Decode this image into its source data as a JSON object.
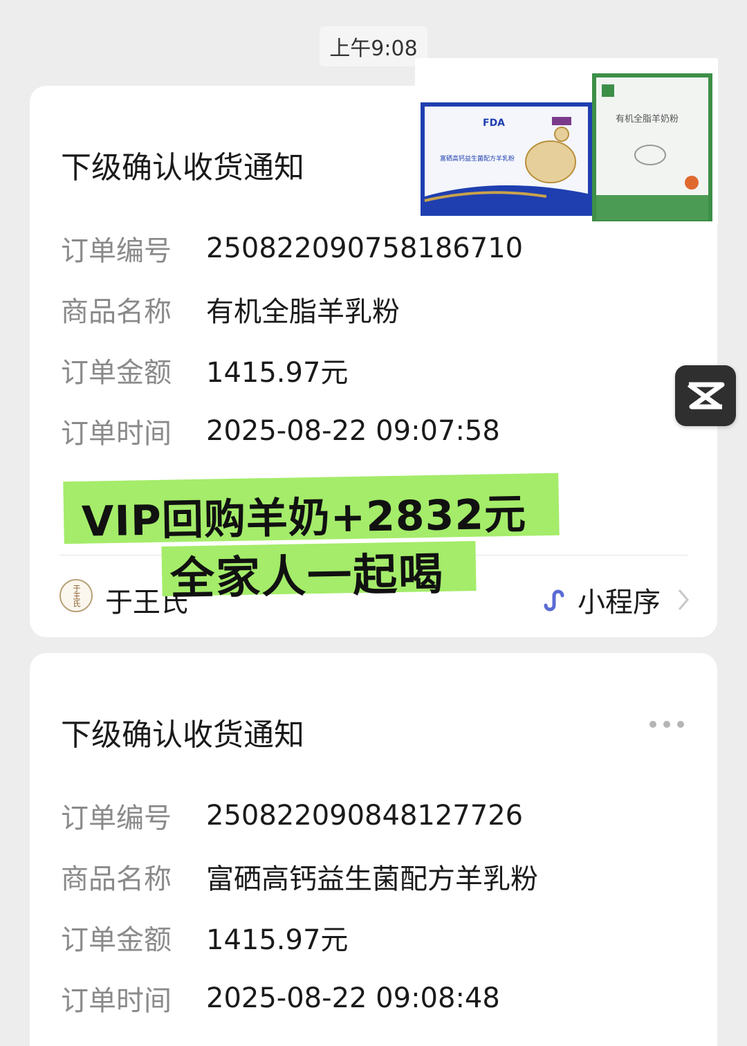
{
  "chat": {
    "timestamp": "上午9:08"
  },
  "cards": [
    {
      "title": "下级确认收货通知",
      "rows": [
        {
          "label": "订单编号",
          "value": "250822090758186710"
        },
        {
          "label": "商品名称",
          "value": "有机全脂羊乳粉"
        },
        {
          "label": "订单金额",
          "value": "1415.97元"
        },
        {
          "label": "订单时间",
          "value": "2025-08-22 09:07:58"
        }
      ],
      "source_name": "于王氏",
      "source_avatar_text": "于王氏",
      "mini_program_label": "小程序"
    },
    {
      "title": "下级确认收货通知",
      "rows": [
        {
          "label": "订单编号",
          "value": "250822090848127726"
        },
        {
          "label": "商品名称",
          "value": "富硒高钙益生菌配方羊乳粉"
        },
        {
          "label": "订单金额",
          "value": "1415.97元"
        },
        {
          "label": "订单时间",
          "value": "2025-08-22 09:08:48"
        }
      ]
    }
  ],
  "product_image": {
    "box1_brand": "FDA",
    "box1_title": "富硒高钙益生菌配方羊乳粉",
    "box2_title": "有机全脂羊奶粉"
  },
  "overlay": {
    "line1": "VIP回购羊奶+2832元",
    "line2": "全家人一起喝"
  },
  "colors": {
    "background": "#ededed",
    "card": "#ffffff",
    "overlay_highlight": "#a4ec6a",
    "mini_icon": "#5b6bd5"
  },
  "icons": [
    "more-icon",
    "mini-program-icon",
    "chevron-right-icon",
    "capcut-icon"
  ]
}
